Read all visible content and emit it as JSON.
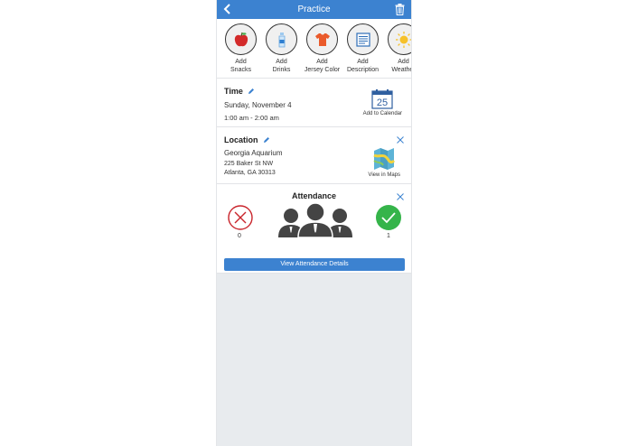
{
  "header": {
    "title": "Practice",
    "back_icon": "chevron-left-icon",
    "trash_icon": "trash-icon"
  },
  "actions": [
    {
      "label": "Add\nSnacks",
      "icon": "apple-icon"
    },
    {
      "label": "Add\nDrinks",
      "icon": "water-bottle-icon"
    },
    {
      "label": "Add\nJersey Color",
      "icon": "jersey-icon"
    },
    {
      "label": "Add\nDescription",
      "icon": "description-icon"
    },
    {
      "label": "Add\nWeather",
      "icon": "sun-icon"
    }
  ],
  "time": {
    "title": "Time",
    "date": "Sunday, November 4",
    "range": "1:00 am - 2:00 am",
    "calendar_day": "25",
    "calendar_caption": "Add to Calendar"
  },
  "location": {
    "title": "Location",
    "name": "Georgia Aquarium",
    "street": "225 Baker St NW",
    "city": "Atlanta, GA 30313",
    "map_caption": "View in Maps"
  },
  "attendance": {
    "title": "Attendance",
    "not_going_count": "0",
    "going_count": "1",
    "details_button": "View Attendance Details"
  },
  "colors": {
    "brand_blue": "#3c82d0",
    "decline_red": "#c9252c",
    "accept_green": "#35b44a"
  }
}
